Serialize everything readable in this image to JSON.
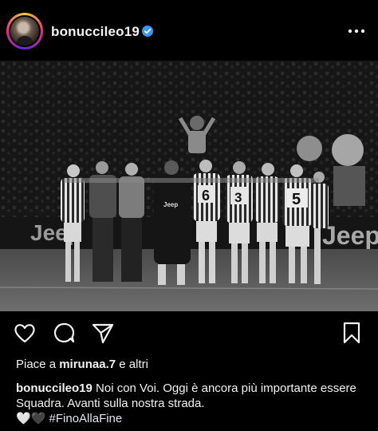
{
  "post": {
    "username": "bonuccileo19",
    "likes": {
      "prefix": "Piace a",
      "liker": "mirunaa.7",
      "suffix": "e altri"
    },
    "caption": {
      "username": "bonuccileo19",
      "text": "Noi con Voi. Oggi è ancora più importante essere Squadra. Avanti sulla nostra strada.",
      "emojis": "🤍🖤",
      "hashtag": "#FinoAllaFine"
    },
    "photo": {
      "ad_left": "Jeep",
      "ad_right": "Jeep",
      "shirt_sponsor": "Jeep",
      "player_numbers": [
        "6",
        "3",
        "5"
      ]
    }
  },
  "icons": {
    "verified": "verified-badge-icon",
    "more": "more-options-icon",
    "like": "heart-icon",
    "comment": "comment-icon",
    "share": "send-icon",
    "save": "bookmark-icon"
  },
  "colors": {
    "background": "#000000",
    "verified": "#3897f0",
    "text": "#f2f2f2"
  }
}
